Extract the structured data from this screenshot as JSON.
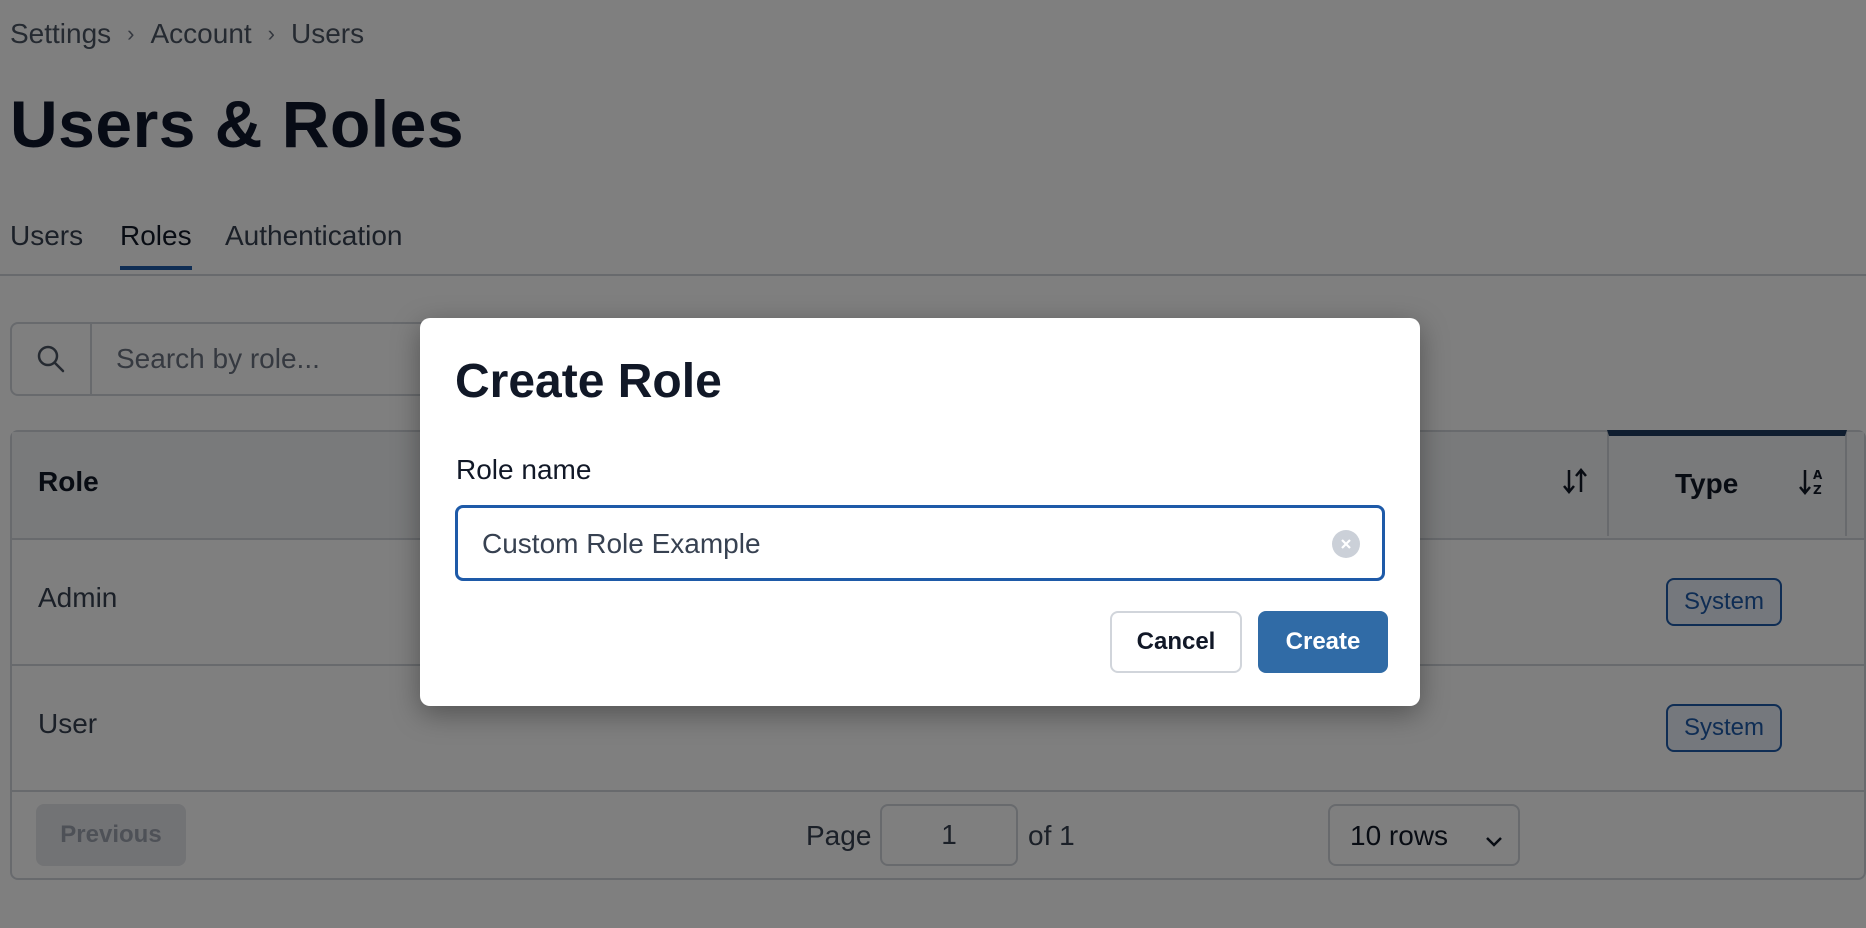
{
  "breadcrumb": [
    "Settings",
    "Account",
    "Users"
  ],
  "page_title": "Users & Roles",
  "tabs": [
    {
      "label": "Users",
      "active": false
    },
    {
      "label": "Roles",
      "active": true
    },
    {
      "label": "Authentication",
      "active": false
    }
  ],
  "search": {
    "placeholder": "Search by role...",
    "icon": "search-icon"
  },
  "table": {
    "columns": {
      "role": "Role",
      "type": "Type"
    },
    "rows": [
      {
        "role": "Admin",
        "type": "System"
      },
      {
        "role": "User",
        "type": "System"
      }
    ],
    "footer": {
      "previous_label": "Previous",
      "page_label": "Page",
      "page_value": "1",
      "of_label": "of 1",
      "rows_label": "10 rows"
    }
  },
  "dialog": {
    "title": "Create Role",
    "field_label": "Role name",
    "field_value": "Custom Role Example",
    "cancel_label": "Cancel",
    "create_label": "Create"
  },
  "colors": {
    "accent": "#1e5aa8",
    "primary_button": "#306ba6",
    "overlay": "rgba(0,0,0,0.5)"
  }
}
